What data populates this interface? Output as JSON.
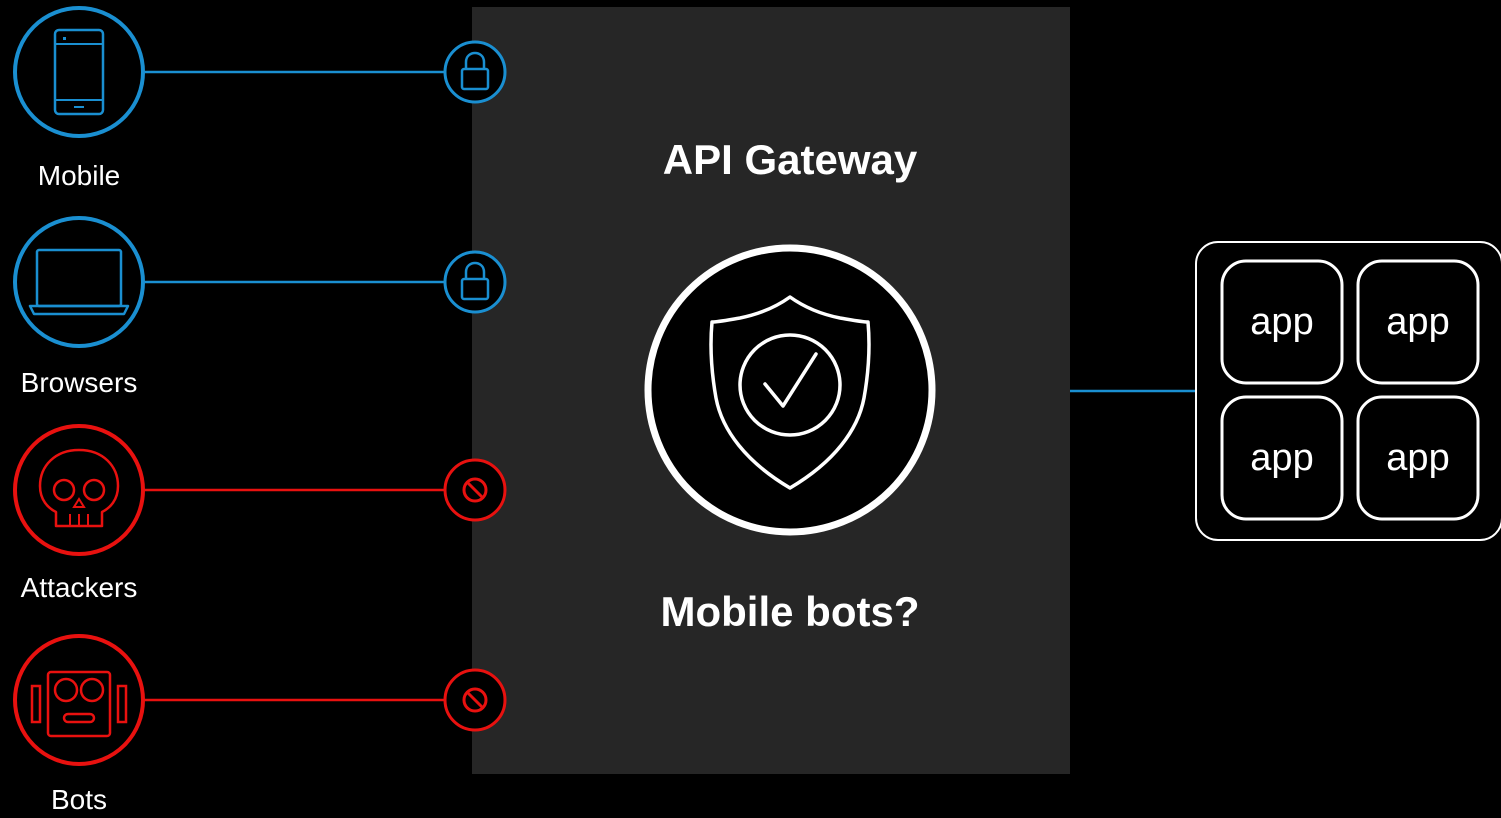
{
  "gateway": {
    "title": "API Gateway",
    "question": "Mobile bots?",
    "shield_icon": "shield-check-icon"
  },
  "clients": [
    {
      "label": "Mobile",
      "icon": "mobile-phone-icon",
      "status": "allowed",
      "badge": "lock-icon",
      "color": "#1a8fd1"
    },
    {
      "label": "Browsers",
      "icon": "laptop-icon",
      "status": "allowed",
      "badge": "lock-icon",
      "color": "#1a8fd1"
    },
    {
      "label": "Attackers",
      "icon": "skull-icon",
      "status": "blocked",
      "badge": "blocked-icon",
      "color": "#e8110f"
    },
    {
      "label": "Bots",
      "icon": "robot-icon",
      "status": "blocked",
      "badge": "blocked-icon",
      "color": "#e8110f"
    }
  ],
  "apps": {
    "tiles": [
      "app",
      "app",
      "app",
      "app"
    ]
  },
  "colors": {
    "background": "#000000",
    "panel": "#262626",
    "allowed": "#1a8fd1",
    "blocked": "#e8110f",
    "foreground": "#ffffff"
  }
}
